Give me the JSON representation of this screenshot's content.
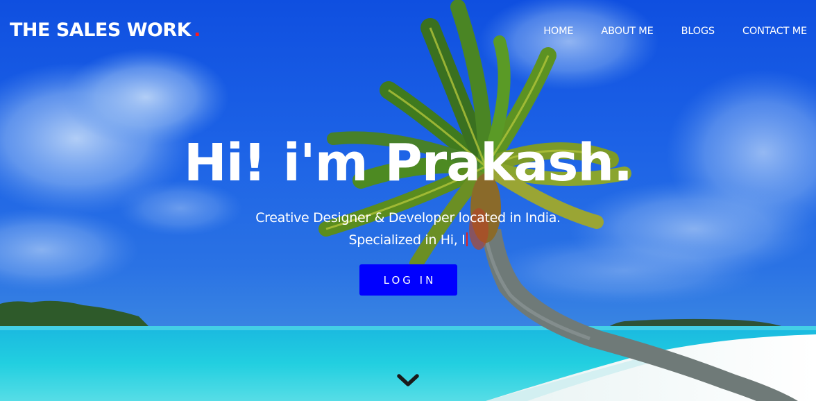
{
  "brand": {
    "name": "THE SALES WORK",
    "dot": ".",
    "accent_color": "#ff1a1a"
  },
  "nav": {
    "items": [
      {
        "label": "HOME"
      },
      {
        "label": "ABOUT ME"
      },
      {
        "label": "BLOGS"
      },
      {
        "label": "CONTACT ME"
      }
    ]
  },
  "hero": {
    "headline": "Hi! i'm Prakash.",
    "subline_1": "Creative Designer & Developer located in India.",
    "subline_2": "Specialized in Hi, I",
    "cta_label": "LOG IN",
    "cta_color": "#0000ff",
    "scroll_icon": "chevron-down-icon"
  }
}
